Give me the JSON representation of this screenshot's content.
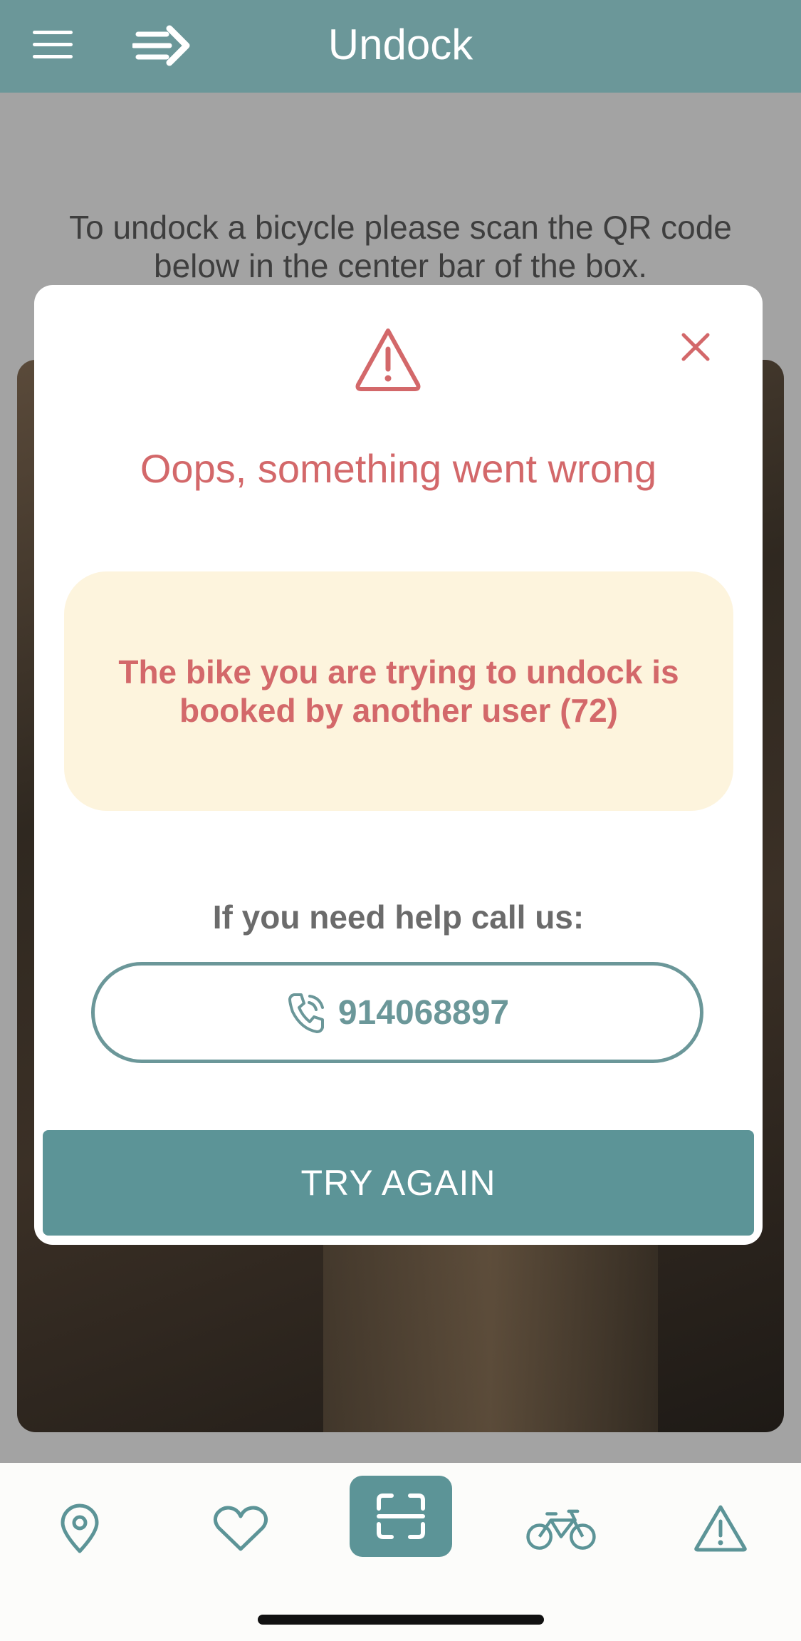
{
  "header": {
    "title": "Undock"
  },
  "page": {
    "instructions": "To undock a bicycle please scan the QR code below in the center bar of the box."
  },
  "modal": {
    "title": "Oops, something went wrong",
    "error_message": "The bike you are trying to undock is booked by another user (72)",
    "help_label": "If you need help call us:",
    "phone_number": "914068897",
    "try_again_label": "TRY AGAIN"
  },
  "icons": {
    "menu": "menu-icon",
    "logo": "logo-icon",
    "warning": "warning-triangle-icon",
    "close": "close-icon",
    "phone": "phone-icon",
    "nav": [
      "map-pin-icon",
      "heart-icon",
      "scan-icon",
      "bike-icon",
      "alert-icon"
    ]
  },
  "colors": {
    "header": "#6b9799",
    "accent": "#5c9497",
    "error": "#d3686a",
    "error_box": "#fdf4dd"
  }
}
